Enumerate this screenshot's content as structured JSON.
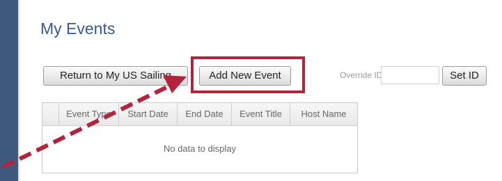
{
  "page": {
    "title": "My Events"
  },
  "toolbar": {
    "return_label": "Return to My US Sailing",
    "add_label": "Add New Event",
    "override_label": "Override ID",
    "override_value": "",
    "set_label": "Set ID"
  },
  "grid": {
    "columns": [
      "",
      "Event Type",
      "Start Date",
      "End Date",
      "Event Title",
      "Host Name"
    ],
    "empty_text": "No data to display"
  },
  "colors": {
    "background": "#3f5a7f",
    "title": "#3a5a8c",
    "highlight": "#b3233b"
  }
}
